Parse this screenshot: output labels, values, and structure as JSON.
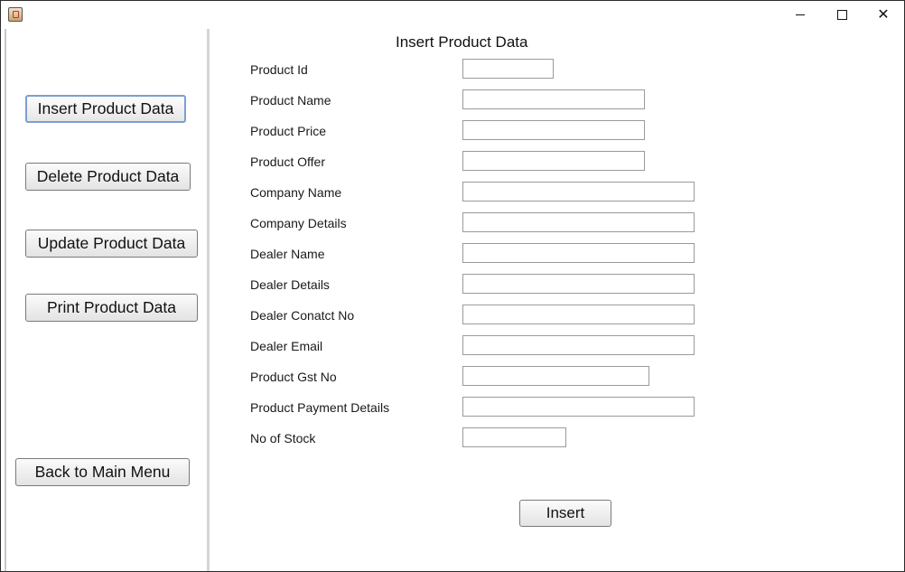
{
  "window": {
    "minimize_glyph": "",
    "close_glyph": "✕"
  },
  "sidebar": {
    "buttons": [
      {
        "label": "Insert Product Data"
      },
      {
        "label": "Delete Product Data"
      },
      {
        "label": "Update Product Data"
      },
      {
        "label": "Print Product Data"
      },
      {
        "label": "Back to Main Menu"
      }
    ]
  },
  "form": {
    "title": "Insert Product Data",
    "fields": [
      {
        "label": "Product Id",
        "value": ""
      },
      {
        "label": "Product Name",
        "value": ""
      },
      {
        "label": "Product Price",
        "value": ""
      },
      {
        "label": "Product Offer",
        "value": ""
      },
      {
        "label": "Company Name",
        "value": ""
      },
      {
        "label": "Company Details",
        "value": ""
      },
      {
        "label": "Dealer Name",
        "value": ""
      },
      {
        "label": "Dealer Details",
        "value": ""
      },
      {
        "label": "Dealer Conatct No",
        "value": ""
      },
      {
        "label": "Dealer Email",
        "value": ""
      },
      {
        "label": "Product Gst No",
        "value": ""
      },
      {
        "label": "Product Payment Details",
        "value": ""
      },
      {
        "label": "No of Stock",
        "value": ""
      }
    ],
    "submit_label": "Insert"
  }
}
